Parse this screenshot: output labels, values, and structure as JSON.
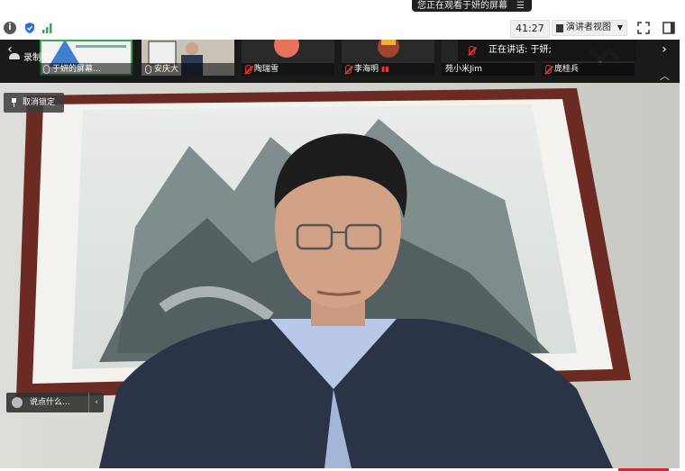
{
  "share_banner": {
    "text": "您正在观看于妍的屏幕",
    "menu_glyph": "☰"
  },
  "toolbar": {
    "timer": "41:27",
    "view_mode": "演讲者视图"
  },
  "recording": {
    "label": "录制中"
  },
  "speaking": {
    "label": "正在讲话: 于妍;"
  },
  "participants": [
    {
      "name": "于妍的屏幕...",
      "muted": false,
      "active": true
    },
    {
      "name": "安庆大",
      "muted": false,
      "active": false
    },
    {
      "name": "陶瑞雪",
      "muted": true,
      "active": false
    },
    {
      "name": "李海明",
      "muted": true,
      "active": false
    },
    {
      "name": "苑小米Jim",
      "muted": false,
      "active": false
    },
    {
      "name": "庞桂兵",
      "muted": true,
      "active": false
    }
  ],
  "unlock_button": {
    "label": "取消锁定"
  },
  "chat": {
    "placeholder": "说点什么...",
    "arrow": "‹"
  },
  "colors": {
    "accent_green": "#3aa657",
    "muted_red": "#e33333",
    "strip_bg": "#1a1a1a"
  }
}
